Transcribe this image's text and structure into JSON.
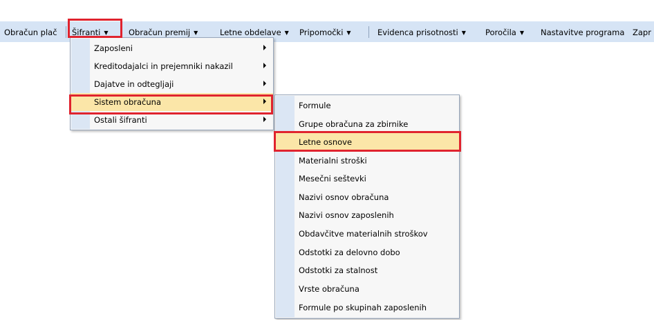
{
  "menubar": {
    "items": [
      {
        "label": "Obračun plač",
        "arrow": false
      },
      {
        "label": "Šifranti",
        "arrow": true
      },
      {
        "label": "Obračun premij",
        "arrow": true
      },
      {
        "label": "Letne obdelave",
        "arrow": true
      },
      {
        "label": "Pripomočki",
        "arrow": true
      },
      {
        "label": "Evidenca prisotnosti",
        "arrow": true
      },
      {
        "label": "Poročila",
        "arrow": true
      },
      {
        "label": "Nastavitve programa",
        "arrow": false
      },
      {
        "label": "Zapr",
        "arrow": false
      }
    ],
    "arrow_glyph": "▼"
  },
  "sifranti_menu": {
    "items": [
      {
        "label": "Zaposleni",
        "submenu": true
      },
      {
        "label": "Kreditodajalci in prejemniki nakazil",
        "submenu": true
      },
      {
        "label": "Dajatve in odtegljaji",
        "submenu": true
      },
      {
        "label": "Sistem obračuna",
        "submenu": true,
        "active": true
      },
      {
        "label": "Ostali šifranti",
        "submenu": true
      }
    ]
  },
  "sistem_obracuna_menu": {
    "items": [
      {
        "label": "Formule"
      },
      {
        "label": "Grupe obračuna za zbirnike"
      },
      {
        "label": "Letne osnove",
        "active": true
      },
      {
        "label": "Materialni stroški"
      },
      {
        "label": "Mesečni seštevki"
      },
      {
        "label": "Nazivi osnov obračuna"
      },
      {
        "label": "Nazivi osnov zaposlenih"
      },
      {
        "label": "Obdavčitve materialnih stroškov"
      },
      {
        "label": "Odstotki za delovno dobo"
      },
      {
        "label": "Odstotki za stalnost"
      },
      {
        "label": "Vrste obračuna"
      },
      {
        "label": "Formule po skupinah zaposlenih"
      }
    ]
  },
  "colors": {
    "menubar_bg": "#d6e4f5",
    "highlight_border": "#e0232e",
    "active_item_bg": "#fbe6a8"
  }
}
